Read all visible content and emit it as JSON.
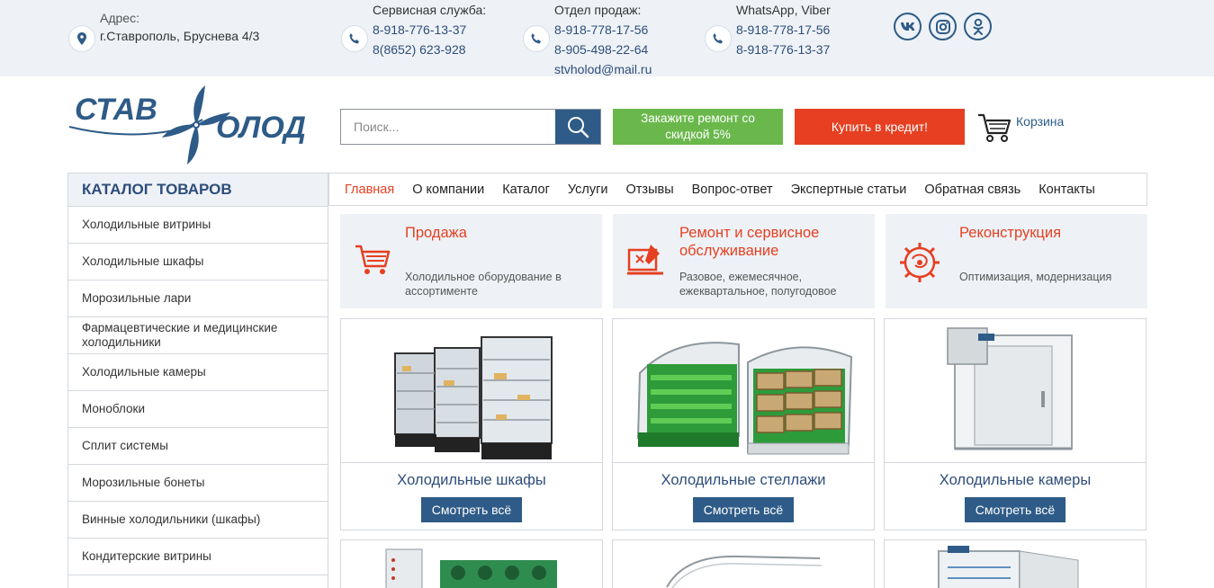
{
  "topbar": {
    "address": {
      "label": "Адрес:",
      "value": "г.Ставрополь, Бруснева 4/3"
    },
    "service": {
      "label": "Сервисная служба:",
      "phone1": "8-918-776-13-37",
      "phone2": "8(8652) 623-928"
    },
    "sales": {
      "label": "Отдел продаж:",
      "phone1": "8-918-778-17-56",
      "phone2": "8-905-498-22-64",
      "email": "stvholod@mail.ru"
    },
    "messengers": {
      "label": "WhatsApp, Viber",
      "phone1": "8-918-778-17-56",
      "phone2": "8-918-776-13-37"
    },
    "social": [
      "vk-icon",
      "instagram-icon",
      "odnoklassniki-icon"
    ]
  },
  "logo": {
    "part1": "СТАВ",
    "part2": "ОЛОД"
  },
  "search": {
    "placeholder": "Поиск..."
  },
  "buttons": {
    "repair": "Закажите ремонт со скидкой 5%",
    "credit": "Купить в кредит!"
  },
  "cart": {
    "label": "Корзина"
  },
  "catalog": {
    "title": "КАТАЛОГ ТОВАРОВ",
    "items": [
      "Холодильные витрины",
      "Холодильные шкафы",
      "Морозильные лари",
      "Фармацевтические и медицинские холодильники",
      "Холодильные камеры",
      "Моноблоки",
      "Сплит системы",
      "Морозильные бонеты",
      "Винные холодильники (шкафы)",
      "Кондитерские витрины"
    ]
  },
  "nav": [
    "Главная",
    "О компании",
    "Каталог",
    "Услуги",
    "Отзывы",
    "Вопрос-ответ",
    "Экспертные статьи",
    "Обратная связь",
    "Контакты"
  ],
  "services": [
    {
      "title": "Продажа",
      "desc": "Холодильное оборудование в ассортименте",
      "icon": "cart-icon"
    },
    {
      "title": "Ремонт и сервисное обслуживание",
      "desc": "Разовое, ежемесячное, ежеквартальное, полугодовое",
      "icon": "repair-icon"
    },
    {
      "title": "Реконструкция",
      "desc": "Оптимизация, модернизация",
      "icon": "brain-gear-icon"
    }
  ],
  "products": [
    {
      "name": "Холодильные шкафы",
      "button": "Смотреть всё"
    },
    {
      "name": "Холодильные стеллажи",
      "button": "Смотреть всё"
    },
    {
      "name": "Холодильные камеры",
      "button": "Смотреть всё"
    }
  ],
  "colors": {
    "brand_blue": "#2e5b87",
    "accent_red": "#e63f21",
    "green": "#6ab84c",
    "topbar_bg": "#eef2f6"
  }
}
